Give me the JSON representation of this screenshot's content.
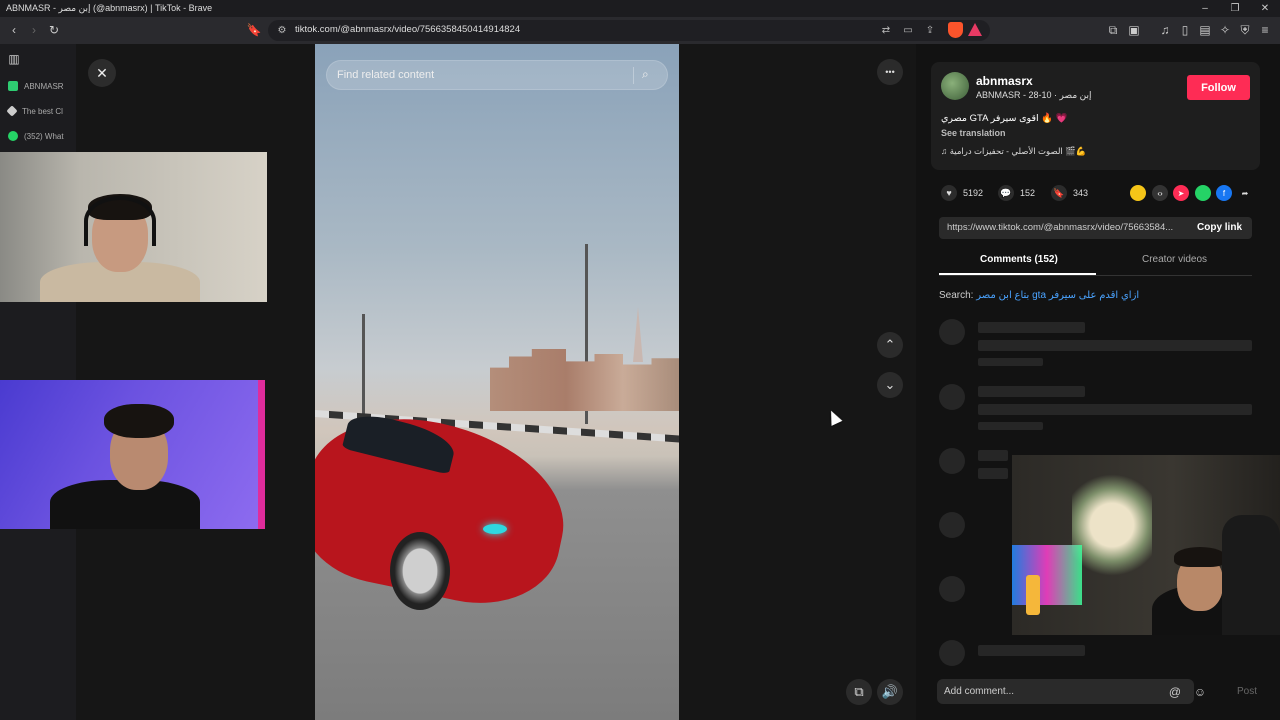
{
  "window": {
    "title": "ABNMASR - إبن مصر (@abnmasrx) | TikTok - Brave",
    "controls": [
      "–",
      "❐",
      "✕"
    ]
  },
  "toolbar": {
    "url": "tiktok.com/@abnmasrx/video/7566358450414914824"
  },
  "sidebar": {
    "items": [
      {
        "label": "ABNMASR",
        "color": "#2ecc71"
      },
      {
        "label": "The best Cl",
        "color": "#cccccc"
      },
      {
        "label": "(352) What",
        "color": "#25d366"
      }
    ]
  },
  "video": {
    "search_placeholder": "Find related content",
    "close_symbol": "✕",
    "more_symbol": "•••",
    "up_symbol": "⌃",
    "down_symbol": "⌄"
  },
  "panel": {
    "username": "abnmasrx",
    "subline": "ABNMASR - إبن مصر · 10-28",
    "follow_label": "Follow",
    "caption": "مصري GTA اقوى سيرفر 🔥 💗",
    "see_translation": "See translation",
    "music": "♫ الصوت الأصلي - تحفيزات درامية 🎬💪",
    "likes": "5192",
    "comments_count": "152",
    "saves": "343",
    "link": "https://www.tiktok.com/@abnmasrx/video/75663584...",
    "copy_link": "Copy link",
    "tab_comments": "Comments (152)",
    "tab_creator": "Creator videos",
    "search_label": "Search:",
    "search_query": "بتاع ابن مصر gta ازاي اقدم على سيرفر",
    "comment_placeholder": "Add comment...",
    "post_label": "Post"
  },
  "colors": {
    "follow": "#fe2c55",
    "accent_link": "#4aa3ff"
  }
}
